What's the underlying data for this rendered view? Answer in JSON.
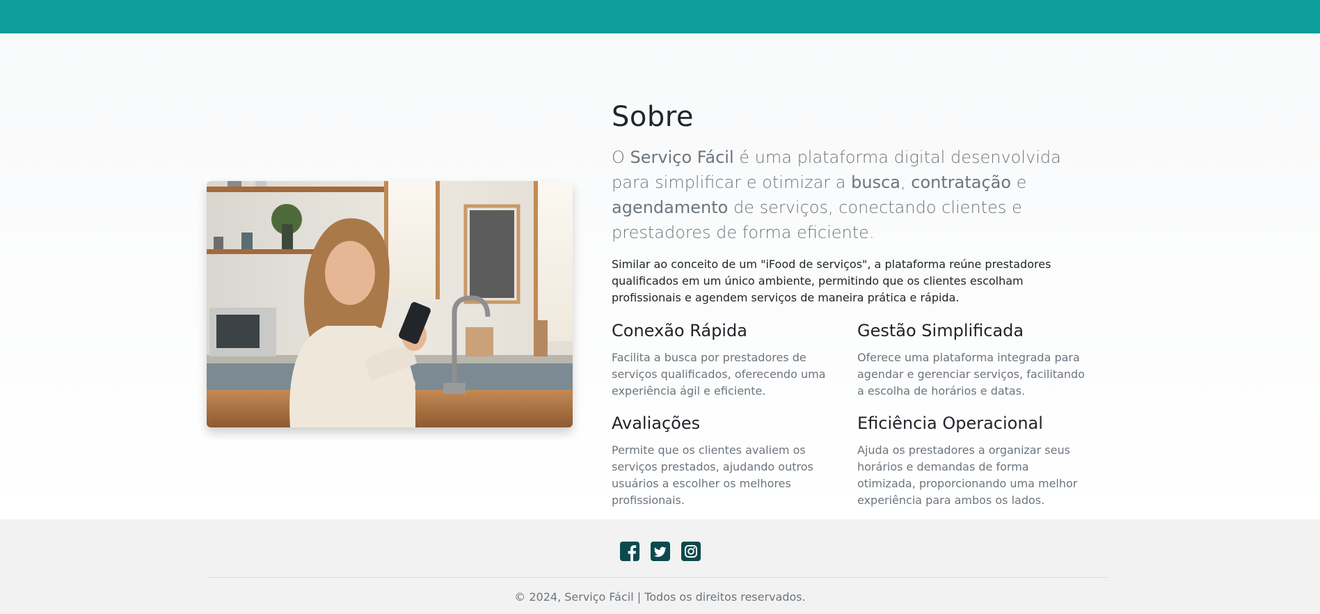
{
  "about": {
    "title": "Sobre",
    "lead": {
      "p1": "O ",
      "brand": "Serviço Fácil",
      "p2": " é uma plataforma digital desenvolvida para simplificar e otimizar a ",
      "k1": "busca",
      "p3": ", ",
      "k2": "contratação",
      "p4": " e ",
      "k3": "agendamento",
      "p5": " de serviços, conectando clientes e prestadores de forma eficiente."
    },
    "description": "Similar ao conceito de um \"iFood de serviços\", a plataforma reúne prestadores qualificados em um único ambiente, permitindo que os clientes escolham profissionais e agendem serviços de maneira prática e rápida.",
    "features": [
      {
        "title": "Conexão Rápida",
        "text": "Facilita a busca por prestadores de serviços qualificados, oferecendo uma experiência ágil e eficiente."
      },
      {
        "title": "Gestão Simplificada",
        "text": "Oferece uma plataforma integrada para agendar e gerenciar serviços, facilitando a escolha de horários e datas."
      },
      {
        "title": "Avaliações",
        "text": "Permite que os clientes avaliem os serviços prestados, ajudando outros usuários a escolher os melhores profissionais."
      },
      {
        "title": "Eficiência Operacional",
        "text": "Ajuda os prestadores a organizar seus horários e demandas de forma otimizada, proporcionando uma melhor experiência para ambos os lados."
      }
    ]
  },
  "footer": {
    "social": [
      {
        "icon": "facebook-icon"
      },
      {
        "icon": "twitter-icon"
      },
      {
        "icon": "instagram-icon"
      }
    ],
    "copyright": "© 2024, Serviço Fácil | Todos os direitos reservados."
  },
  "colors": {
    "topbar": "#0e9e9b",
    "social_icon": "#0b4a4e",
    "heading": "#212529",
    "muted": "#6c757d",
    "footer_bg": "#f2f2f2"
  }
}
